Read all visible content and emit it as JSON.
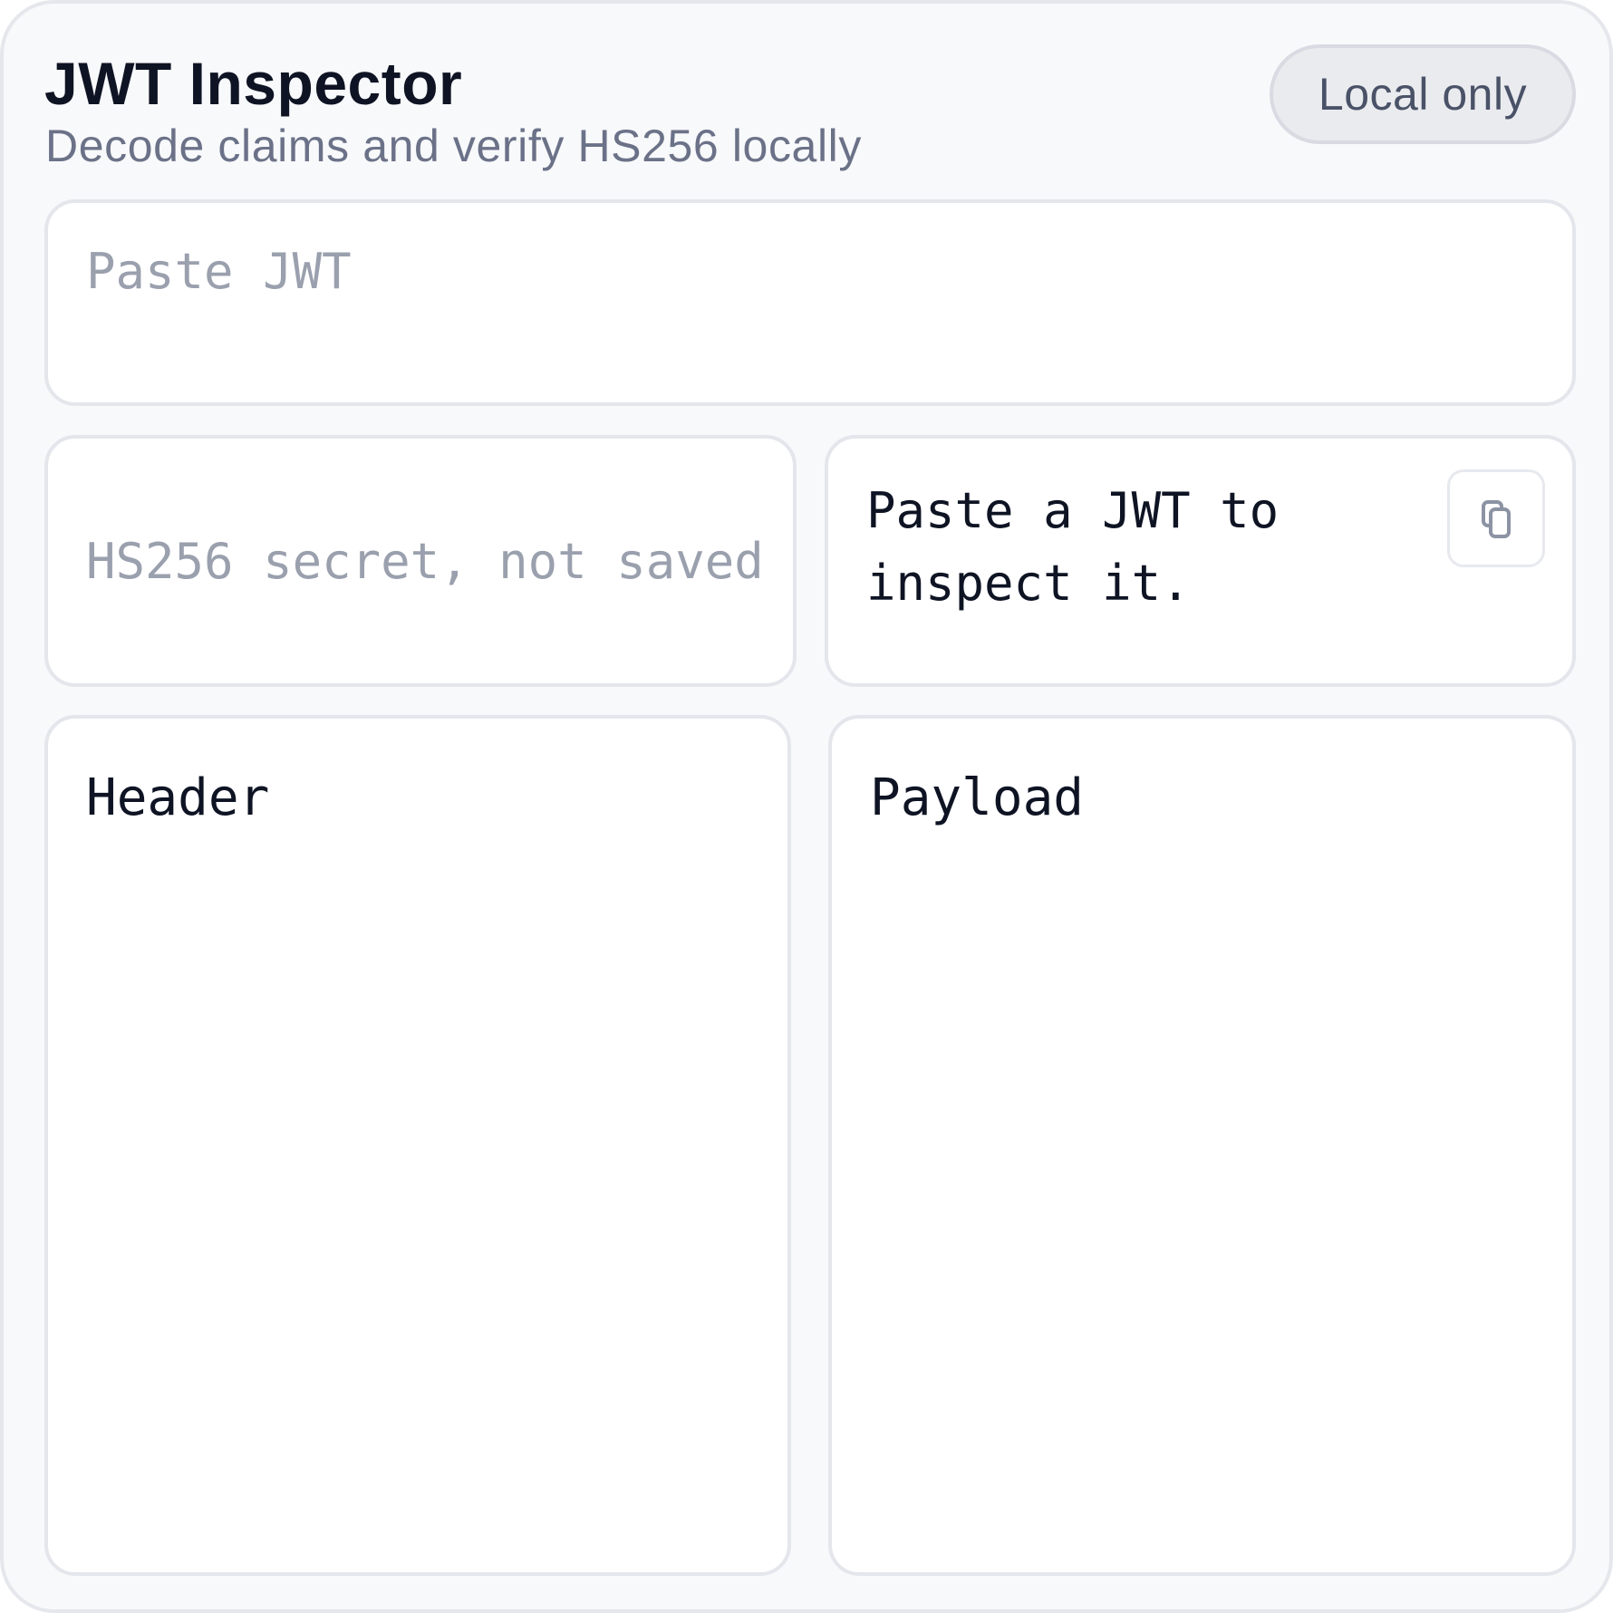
{
  "header": {
    "title": "JWT Inspector",
    "subtitle": "Decode claims and verify HS256 locally",
    "badge": "Local only"
  },
  "jwt_input": {
    "placeholder": "Paste JWT",
    "value": ""
  },
  "secret_input": {
    "placeholder": "HS256 secret, not saved",
    "value": ""
  },
  "status": {
    "message": "Paste a JWT to inspect it.",
    "copy_icon": "copy-icon"
  },
  "panels": {
    "header_label": "Header",
    "header_content": "",
    "payload_label": "Payload",
    "payload_content": ""
  },
  "colors": {
    "background": "#f8f9fb",
    "panel": "#ffffff",
    "border": "#e4e6ec",
    "title_text": "#0f1424",
    "muted_text": "#6b7288",
    "placeholder_text": "#9aa0ad",
    "badge_bg": "#eaebee"
  }
}
